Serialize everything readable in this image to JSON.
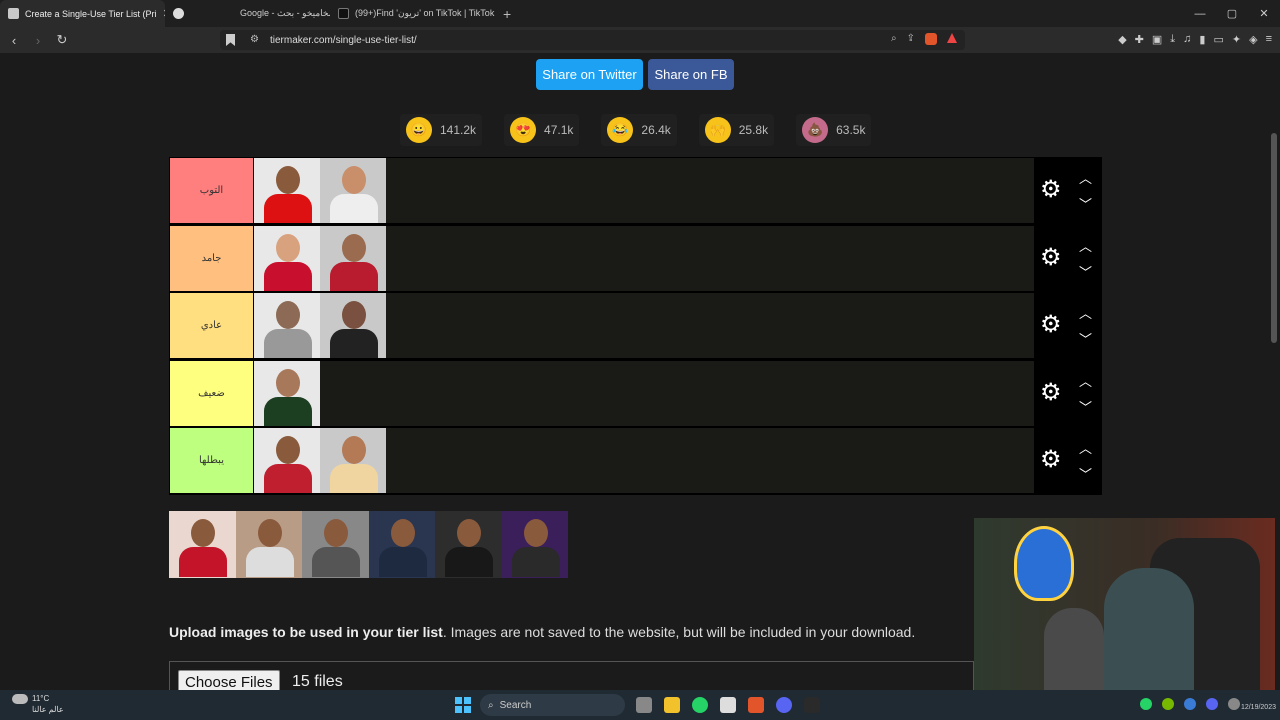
{
  "browser": {
    "tabs": [
      {
        "title": "Create a Single-Use Tier List (Pri",
        "active": true
      },
      {
        "title": "Google - مخاميخو - بحث",
        "active": false
      },
      {
        "title": "(99+)Find 'تريون' on TikTok | TikTok Se",
        "active": false
      }
    ],
    "new_tab": "+",
    "url": "tiermaker.com/single-use-tier-list/",
    "window_controls": [
      "—",
      "▢",
      "✕"
    ]
  },
  "share": {
    "twitter": "Share on Twitter",
    "facebook": "Share on FB"
  },
  "reactions": [
    {
      "icon": "grin-emoji-icon",
      "glyph": "😀",
      "count": "141.2k"
    },
    {
      "icon": "heart-eyes-emoji-icon",
      "glyph": "😍",
      "count": "47.1k"
    },
    {
      "icon": "laugh-emoji-icon",
      "glyph": "😂",
      "count": "26.4k"
    },
    {
      "icon": "raised-hands-emoji-icon",
      "glyph": "🙌",
      "count": "25.8k"
    },
    {
      "icon": "poo-emoji-icon",
      "glyph": "💩",
      "count": "63.5k"
    }
  ],
  "tiers": [
    {
      "label": "التوب",
      "color": "#ff7f7f",
      "items": 2
    },
    {
      "label": "جامد",
      "color": "#ffbf7f",
      "items": 2
    },
    {
      "label": "عادي",
      "color": "#ffdf7f",
      "items": 2
    },
    {
      "label": "ضعيف",
      "color": "#ffff7f",
      "items": 1
    },
    {
      "label": "يبطلها",
      "color": "#bfff7f",
      "items": 2
    }
  ],
  "pool_count": 6,
  "upload": {
    "bold": "Upload images to be used in your tier list",
    "rest": ". Images are not saved to the website, but will be included in your download.",
    "button": "Choose Files",
    "files": "15 files"
  },
  "taskbar": {
    "temp": "11°C",
    "location": "عالم عالنا",
    "search": "Search",
    "date": "12/19/2023"
  }
}
